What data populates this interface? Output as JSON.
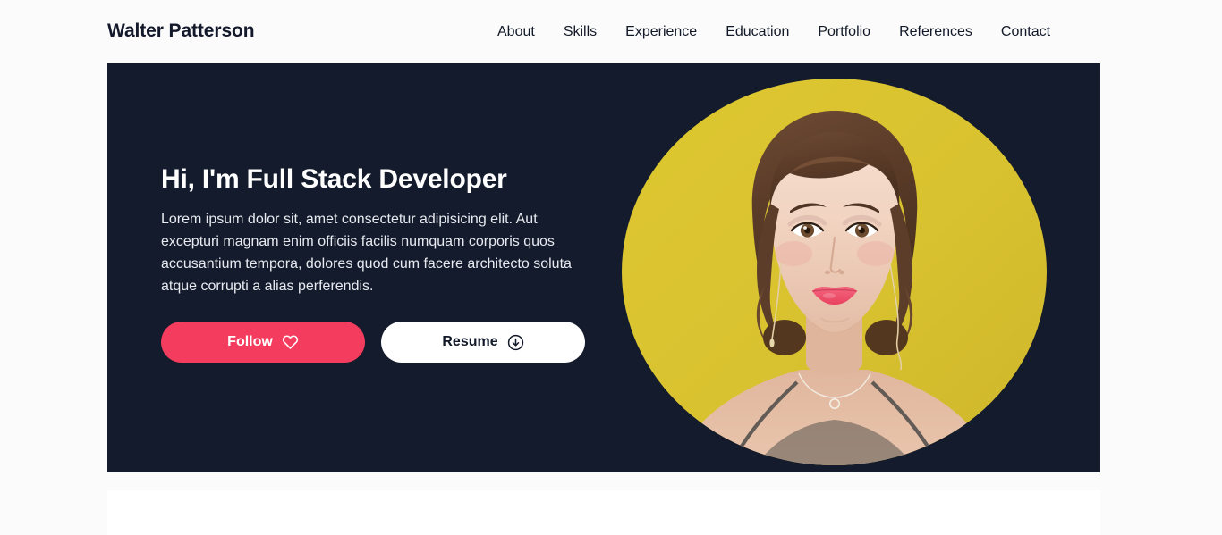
{
  "header": {
    "brand": "Walter Patterson",
    "nav": [
      {
        "label": "About"
      },
      {
        "label": "Skills"
      },
      {
        "label": "Experience"
      },
      {
        "label": "Education"
      },
      {
        "label": "Portfolio"
      },
      {
        "label": "References"
      },
      {
        "label": "Contact"
      }
    ]
  },
  "hero": {
    "title": "Hi, I'm Full Stack Developer",
    "description": "Lorem ipsum dolor sit, amet consectetur adipisicing elit. Aut excepturi magnam enim officiis facilis numquam corporis quos accusantium tempora, dolores quod cum facere architecto soluta atque corrupti a alias perferendis.",
    "buttons": {
      "follow": {
        "label": "Follow",
        "icon": "heart-icon"
      },
      "resume": {
        "label": "Resume",
        "icon": "download-circle-icon"
      }
    },
    "photo": {
      "alt": "portrait-photo",
      "background_color": "#d9c22f",
      "shape": "ellipse"
    }
  },
  "colors": {
    "page_background": "#fbfbfb",
    "hero_background": "#131b2c",
    "accent_pink": "#f43d5e",
    "photo_yellow": "#d9c22f",
    "text_dark": "#111827",
    "text_light": "#ffffff",
    "card_white": "#ffffff",
    "scrollbar_track": "#f1f1f1",
    "scrollbar_thumb": "#c1c1c1"
  },
  "scrollbar": {
    "up_arrow": "scroll-up-arrow",
    "down_arrow": "scroll-down-arrow",
    "position": "top"
  }
}
